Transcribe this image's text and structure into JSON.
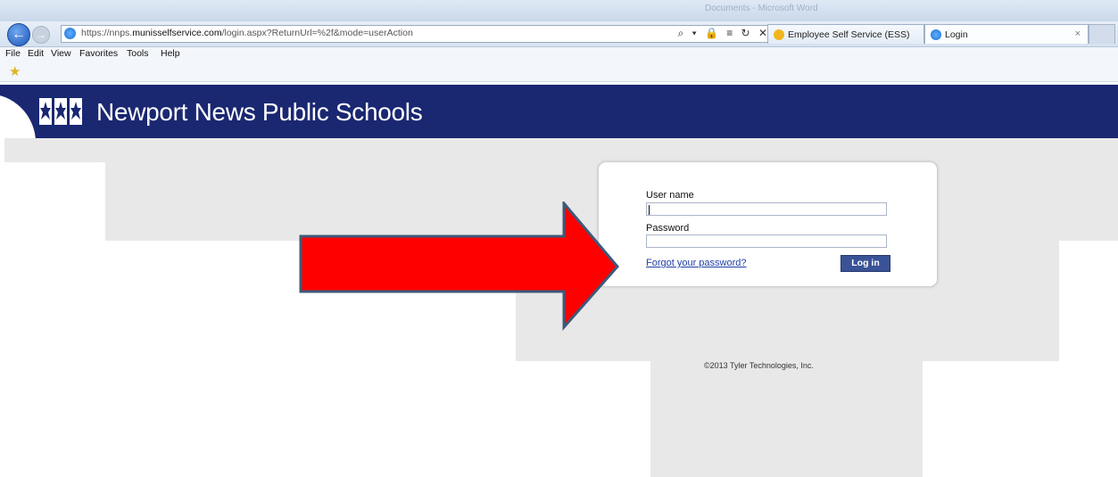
{
  "browser": {
    "faded_title": "Documents - Microsoft Word",
    "url_prefix": "https://nnps.",
    "url_domain": "munisselfservice.com",
    "url_path": "/login.aspx?ReturnUrl=%2f&mode=userAction",
    "address_tools": "⌕ ▾ 🔒 ≡ ↻ ✕",
    "tabs": [
      {
        "label": "Employee Self Service (ESS)",
        "icon": "ess-star-icon"
      },
      {
        "label": "Login",
        "icon": "ie-page-icon",
        "active": true
      }
    ],
    "tab_close": "×",
    "menu": [
      "File",
      "Edit",
      "View",
      "Favorites",
      "Tools",
      "Help"
    ]
  },
  "site": {
    "title": "Newport News Public Schools",
    "logo": "nnps-logo",
    "banner_color": "#1a2771"
  },
  "login": {
    "username_label": "User name",
    "username_value": "",
    "password_label": "Password",
    "password_value": "",
    "forgot_link": "Forgot your password?",
    "login_button": "Log in"
  },
  "footer": {
    "copyright": "©2013 Tyler Technologies, Inc."
  },
  "annotation": {
    "arrow_color": "#ff0000",
    "arrow_border": "#3b5a7a"
  }
}
